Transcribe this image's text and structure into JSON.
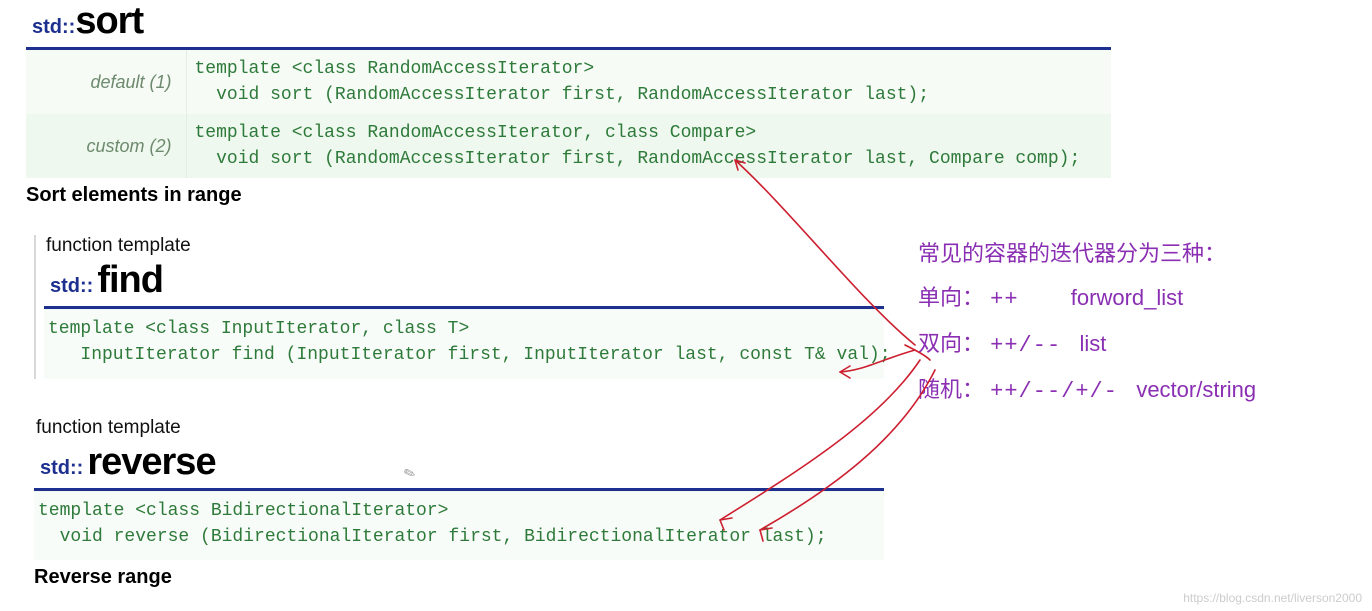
{
  "sort": {
    "ns": "std::",
    "name": "sort",
    "sigs": [
      {
        "label": "default (1)",
        "code": "template <class RandomAccessIterator>\n  void sort (RandomAccessIterator first, RandomAccessIterator last);"
      },
      {
        "label": "custom (2)",
        "code": "template <class RandomAccessIterator, class Compare>\n  void sort (RandomAccessIterator first, RandomAccessIterator last, Compare comp);"
      }
    ],
    "subtitle": "Sort elements in range"
  },
  "find": {
    "ft": "function template",
    "ns": "std::",
    "name": "find",
    "code": "template <class InputIterator, class T>\n   InputIterator find (InputIterator first, InputIterator last, const T& val);"
  },
  "reverse": {
    "ft": "function template",
    "ns": "std::",
    "name": "reverse",
    "code": "template <class BidirectionalIterator>\n  void reverse (BidirectionalIterator first, BidirectionalIterator last);",
    "subtitle": "Reverse range"
  },
  "annotation": {
    "heading": "常见的容器的迭代器分为三种：",
    "rows": [
      {
        "kind": "单向：",
        "ops": "++",
        "ex": "forword_list"
      },
      {
        "kind": "双向：",
        "ops": "++/--",
        "ex": "list"
      },
      {
        "kind": "随机：",
        "ops": "++/--/+/-",
        "ex": "vector/string"
      }
    ]
  },
  "watermark": "https://blog.csdn.net/liverson2000"
}
